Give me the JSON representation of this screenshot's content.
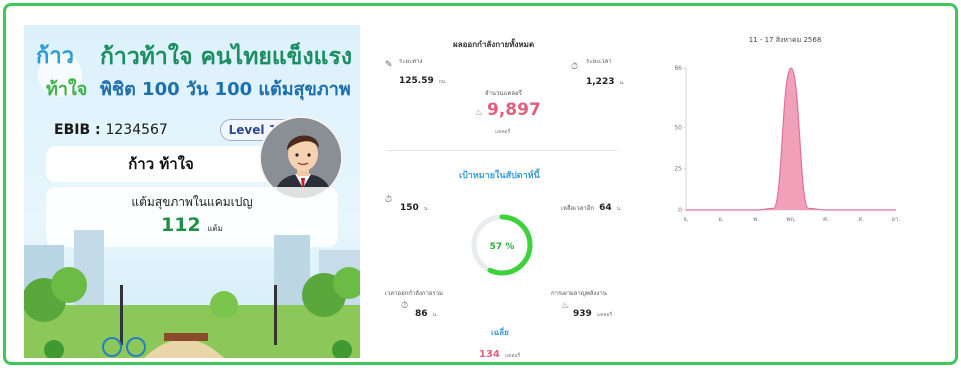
{
  "card": {
    "logo_text": "ก้าว ท้าใจ",
    "headline": "ก้าวท้าใจ คนไทยแข็งแรง",
    "subline": "พิชิต 100 วัน 100 แต้มสุขภาพ",
    "ebib_label": "EBIB : ",
    "ebib_value": "1234567",
    "level": "Level 12",
    "name": "ก้าว ท้าใจ",
    "points_label": "แต้มสุขภาพในแคมเปญ",
    "points_value": "112",
    "points_unit": "แต้ม"
  },
  "summary": {
    "title": "ผลออกกำลังกายทั้งหมด",
    "distance_label": "ระยะทาง",
    "distance_value": "125.59",
    "distance_unit": "กม.",
    "time_label": "ระยะเวลา",
    "time_value": "1,223",
    "time_unit": "น.",
    "calories_label": "จำนวนแคลอรี่",
    "calories_value": "9,897",
    "calories_unit": "แคลอรี่",
    "weekly_title": "เป้าหมายในสัปดาห์นี้",
    "weekly_minutes_value": "150",
    "weekly_minutes_unit": "น.",
    "days_left_label": "เหลือเวลาอีก",
    "days_left_value": "64",
    "days_left_unit": "น.",
    "progress_text": "57 %",
    "progress_fraction": 0.57,
    "total_time_label": "เวลาออกกำลังกายรวม",
    "total_time_value": "86",
    "total_time_unit": "น.",
    "energy_label": "การเผาผลาญพลังงาน",
    "energy_value": "939",
    "energy_unit": "แคลอรี่",
    "avg_label": "เฉลี่ย",
    "avg_value": "134",
    "avg_unit": "แคลอรี่"
  },
  "colors": {
    "accent_green": "#3cc85a",
    "headline_green": "#1c8e62",
    "calorie_pink": "#e06080",
    "weekly_blue": "#3a9fd8",
    "chart_fill": "#f0a0b8",
    "chart_stroke": "#e070a0"
  },
  "chart_data": {
    "type": "area",
    "title": "11 - 17 สิงหาคม 2568",
    "categories": [
      "จ.",
      "อ.",
      "พ.",
      "พฤ.",
      "ศ.",
      "ส.",
      "อา."
    ],
    "x": [
      0,
      0.5,
      1,
      1.5,
      2,
      2.5,
      3,
      3.5,
      4,
      4.5,
      5,
      5.5,
      6
    ],
    "values": [
      0,
      0,
      0,
      0,
      0,
      1,
      86,
      1,
      0,
      0,
      0,
      0,
      0
    ],
    "yticks": [
      0,
      25,
      50,
      86
    ],
    "ylim": [
      0,
      86
    ],
    "grid": false
  }
}
